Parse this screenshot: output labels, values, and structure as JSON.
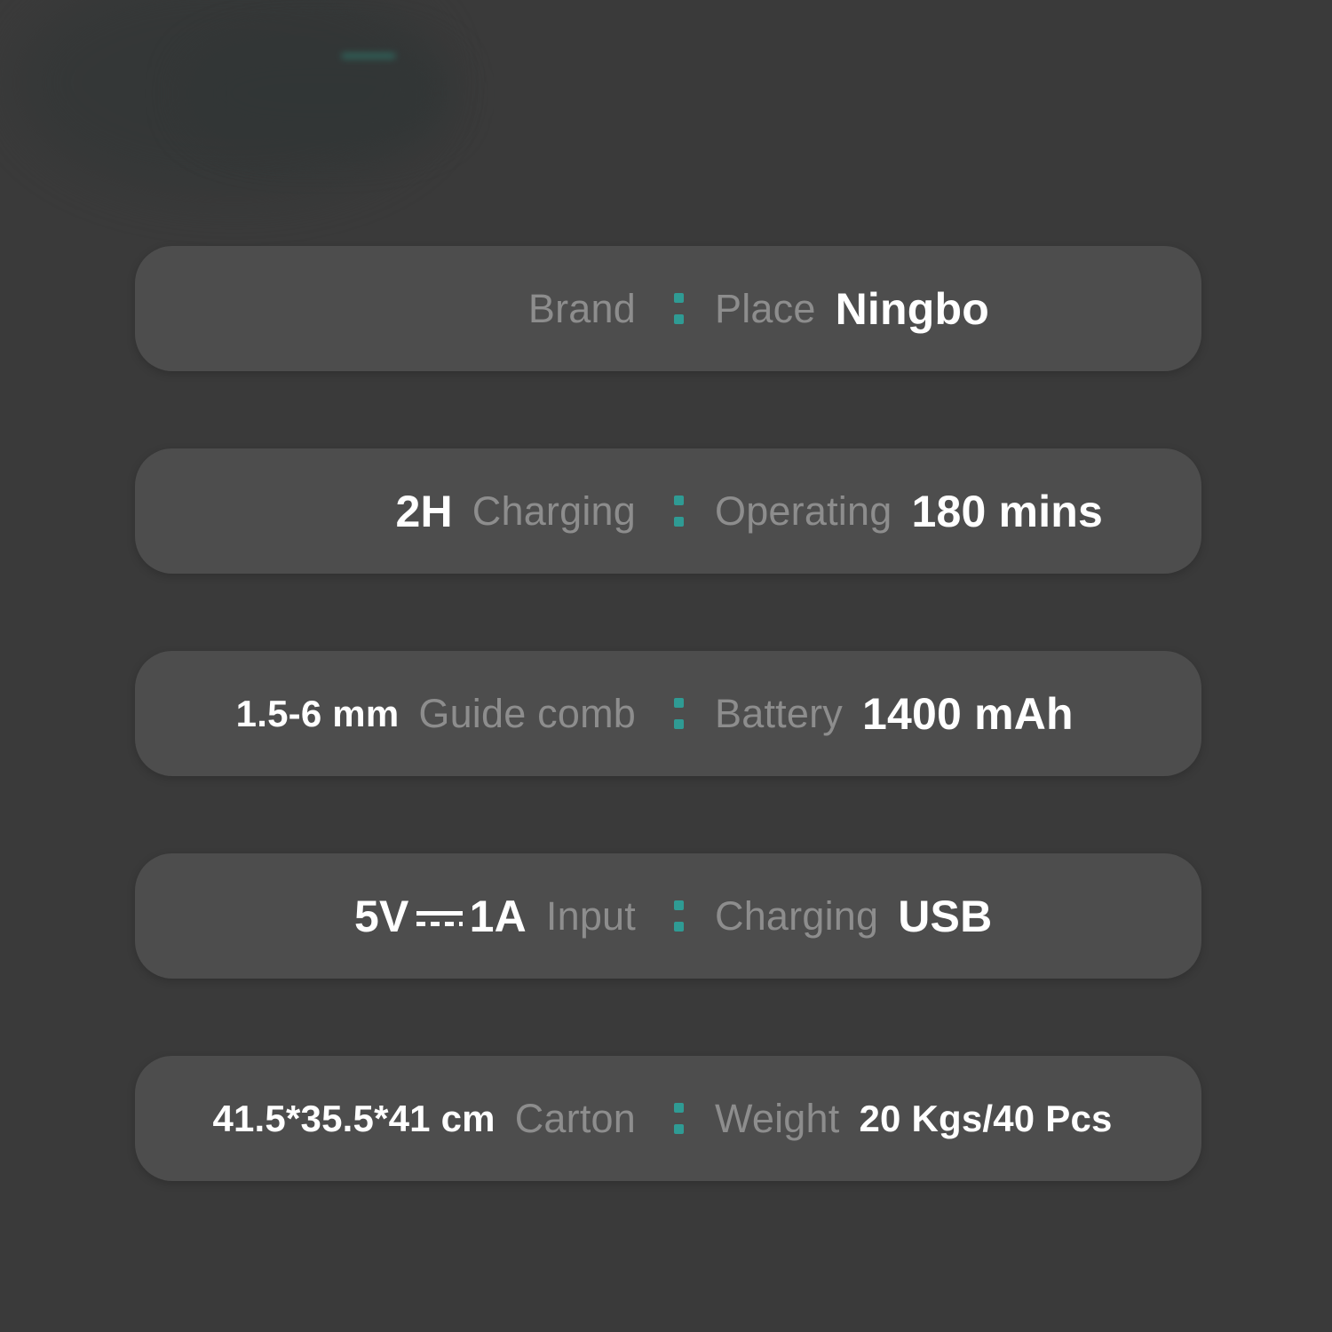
{
  "theme": {
    "background_color": "#3a3a3a",
    "row_color": "#4d4d4d",
    "label_color": "#8d8d8d",
    "value_color": "#ffffff",
    "separator_color": "#2f9b94"
  },
  "spec_sheet": {
    "separator_glyph": ":",
    "rows": [
      {
        "left_value": "",
        "left_label": "Brand",
        "right_label": "Place",
        "right_value": "Ningbo"
      },
      {
        "left_value": "2H",
        "left_label": "Charging",
        "right_label": "Operating",
        "right_value": "180 mins"
      },
      {
        "left_value": "1.5-6 mm",
        "left_label": "Guide comb",
        "right_label": "Battery",
        "right_value": "1400 mAh"
      },
      {
        "left_value_prefix": "5V",
        "left_value_symbol": "dc-power-symbol",
        "left_value_suffix": "1A",
        "left_label": "Input",
        "right_label": "Charging",
        "right_value": "USB"
      },
      {
        "left_value": "41.5*35.5*41 cm",
        "left_label": "Carton",
        "right_label": "Weight",
        "right_value": "20 Kgs/40 Pcs"
      }
    ]
  }
}
